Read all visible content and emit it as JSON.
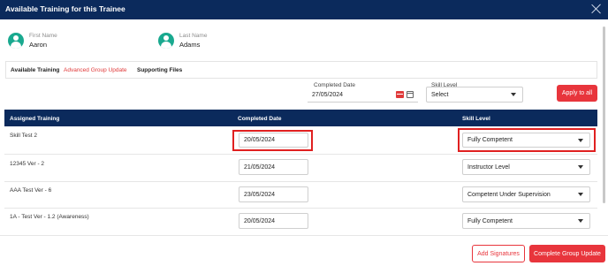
{
  "modal": {
    "title": "Available Training for this Trainee"
  },
  "trainee": {
    "first_name_label": "First Name",
    "first_name": "Aaron",
    "last_name_label": "Last Name",
    "last_name": "Adams"
  },
  "tabs": [
    {
      "label": "Available Training",
      "active": true
    },
    {
      "label": "Advanced Group Update",
      "active": false
    },
    {
      "label": "Supporting Files",
      "active": false
    }
  ],
  "filters": {
    "completed_date_label": "Completed Date",
    "completed_date_value": "27/05/2024",
    "skill_level_label": "Skill Level",
    "skill_level_value": "Select",
    "apply_button": "Apply to all"
  },
  "table": {
    "headers": [
      "Assigned Training",
      "Completed Date",
      "Skill Level"
    ],
    "rows": [
      {
        "name": "Skill Test 2",
        "date": "20/05/2024",
        "skill": "Fully Competent"
      },
      {
        "name": "12345 Ver - 2",
        "date": "21/05/2024",
        "skill": "Instructor Level"
      },
      {
        "name": "AAA Test Ver - 6",
        "date": "23/05/2024",
        "skill": "Competent Under Supervision"
      },
      {
        "name": "1A - Test Ver - 1.2 (Awareness)",
        "date": "20/05/2024",
        "skill": "Fully Competent"
      }
    ]
  },
  "footer": {
    "add_signatures": "Add Signatures",
    "complete_update": "Complete Group Update"
  },
  "colors": {
    "header_navy": "#0b2a5c",
    "accent_red": "#e8353c",
    "avatar_teal": "#19a98f"
  }
}
